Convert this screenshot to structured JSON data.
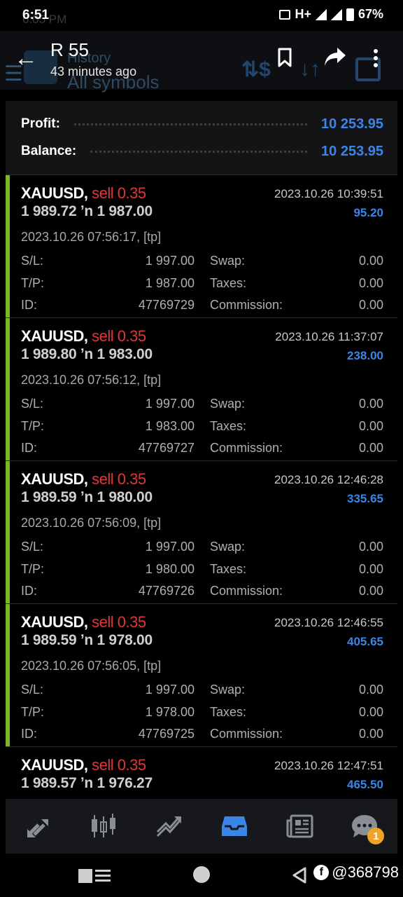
{
  "status_bar": {
    "time": "6:51",
    "ghost_time": "6:05 PM",
    "network": "H+",
    "battery": "67%"
  },
  "header": {
    "title": "R 55",
    "subtitle": "43 minutes ago",
    "bg_history": "History",
    "bg_all_symbols": "All symbols"
  },
  "summary": {
    "profit_label": "Profit:",
    "profit_value": "10 253.95",
    "balance_label": "Balance:",
    "balance_value": "10 253.95"
  },
  "labels": {
    "sl": "S/L:",
    "tp": "T/P:",
    "id": "ID:",
    "swap": "Swap:",
    "taxes": "Taxes:",
    "commission": "Commission:"
  },
  "deals": [
    {
      "symbol": "XAUUSD,",
      "side": "sell 0.35",
      "close_time": "2023.10.26 10:39:51",
      "prices": "1 989.72 ʼn  1 987.00",
      "profit": "95.20",
      "opened": "2023.10.26 07:56:17, [tp]",
      "sl": "1 997.00",
      "tp": "1 987.00",
      "id": "47769729",
      "swap": "0.00",
      "taxes": "0.00",
      "commission": "0.00"
    },
    {
      "symbol": "XAUUSD,",
      "side": "sell 0.35",
      "close_time": "2023.10.26 11:37:07",
      "prices": "1 989.80 ʼn  1 983.00",
      "profit": "238.00",
      "opened": "2023.10.26 07:56:12, [tp]",
      "sl": "1 997.00",
      "tp": "1 983.00",
      "id": "47769727",
      "swap": "0.00",
      "taxes": "0.00",
      "commission": "0.00"
    },
    {
      "symbol": "XAUUSD,",
      "side": "sell 0.35",
      "close_time": "2023.10.26 12:46:28",
      "prices": "1 989.59 ʼn  1 980.00",
      "profit": "335.65",
      "opened": "2023.10.26 07:56:09, [tp]",
      "sl": "1 997.00",
      "tp": "1 980.00",
      "id": "47769726",
      "swap": "0.00",
      "taxes": "0.00",
      "commission": "0.00"
    },
    {
      "symbol": "XAUUSD,",
      "side": "sell 0.35",
      "close_time": "2023.10.26 12:46:55",
      "prices": "1 989.59 ʼn  1 978.00",
      "profit": "405.65",
      "opened": "2023.10.26 07:56:05, [tp]",
      "sl": "1 997.00",
      "tp": "1 978.00",
      "id": "47769725",
      "swap": "0.00",
      "taxes": "0.00",
      "commission": "0.00"
    },
    {
      "symbol": "XAUUSD,",
      "side": "sell 0.35",
      "close_time": "2023.10.26 12:47:51",
      "prices": "1 989.57 ʼn  1 976.27",
      "profit": "465.50"
    }
  ],
  "bottom_nav": {
    "items": [
      "quotes-icon",
      "chart-icon",
      "trade-icon",
      "history-icon",
      "news-icon",
      "chat-icon"
    ],
    "active": "history-icon",
    "chat_badge": "1",
    "accent": "#3a86e8"
  },
  "watermark": "@368798",
  "colors": {
    "profit_blue": "#3a86e8",
    "sell_red": "#e0363a",
    "deal_bar_green": "#7db52e"
  }
}
